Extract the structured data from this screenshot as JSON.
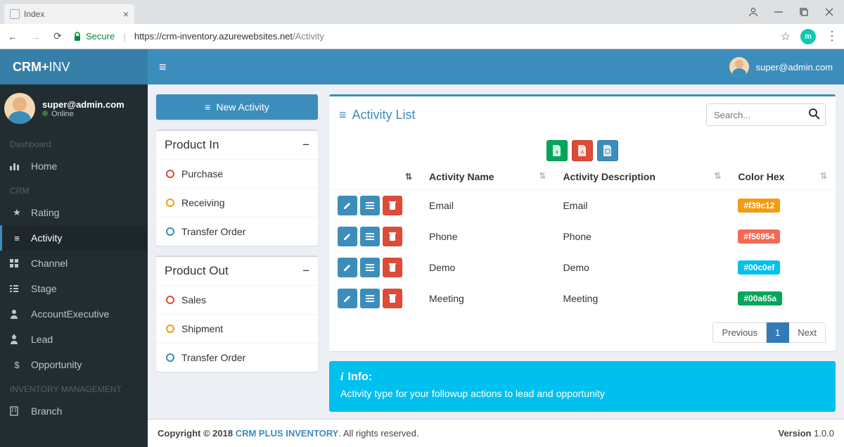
{
  "browser": {
    "tab_title": "Index",
    "secure_label": "Secure",
    "url_host": "https://crm-inventory.azurewebsites.net",
    "url_path": "/Activity"
  },
  "brand": {
    "a": "CRM+",
    "b": "INV"
  },
  "topbar": {
    "user": "super@admin.com"
  },
  "user_panel": {
    "name": "super@admin.com",
    "status": "Online"
  },
  "side": {
    "sec_dashboard": "Dashboard",
    "home": "Home",
    "sec_crm": "CRM",
    "rating": "Rating",
    "activity": "Activity",
    "channel": "Channel",
    "stage": "Stage",
    "account_exec": "AccountExecutive",
    "lead": "Lead",
    "opportunity": "Opportunity",
    "sec_inventory": "INVENTORY MANAGEMENT",
    "branch": "Branch"
  },
  "left": {
    "new_activity": "New Activity",
    "product_in": "Product In",
    "in_items": [
      "Purchase",
      "Receiving",
      "Transfer Order"
    ],
    "product_out": "Product Out",
    "out_items": [
      "Sales",
      "Shipment",
      "Transfer Order"
    ]
  },
  "list": {
    "title": "Activity List",
    "search_placeholder": "Search...",
    "cols": {
      "name": "Activity Name",
      "desc": "Activity Description",
      "hex": "Color Hex"
    },
    "rows": [
      {
        "name": "Email",
        "desc": "Email",
        "hex": "#f39c12"
      },
      {
        "name": "Phone",
        "desc": "Phone",
        "hex": "#f56954"
      },
      {
        "name": "Demo",
        "desc": "Demo",
        "hex": "#00c0ef"
      },
      {
        "name": "Meeting",
        "desc": "Meeting",
        "hex": "#00a65a"
      }
    ],
    "pager": {
      "prev": "Previous",
      "page": "1",
      "next": "Next"
    }
  },
  "info": {
    "title": "Info:",
    "text": "Activity type for your followup actions to lead and opportunity"
  },
  "footer": {
    "copyright": "Copyright © 2018 ",
    "brand": "CRM PLUS INVENTORY",
    "rights": ". All rights reserved.",
    "version_lbl": "Version ",
    "version": "1.0.0"
  }
}
